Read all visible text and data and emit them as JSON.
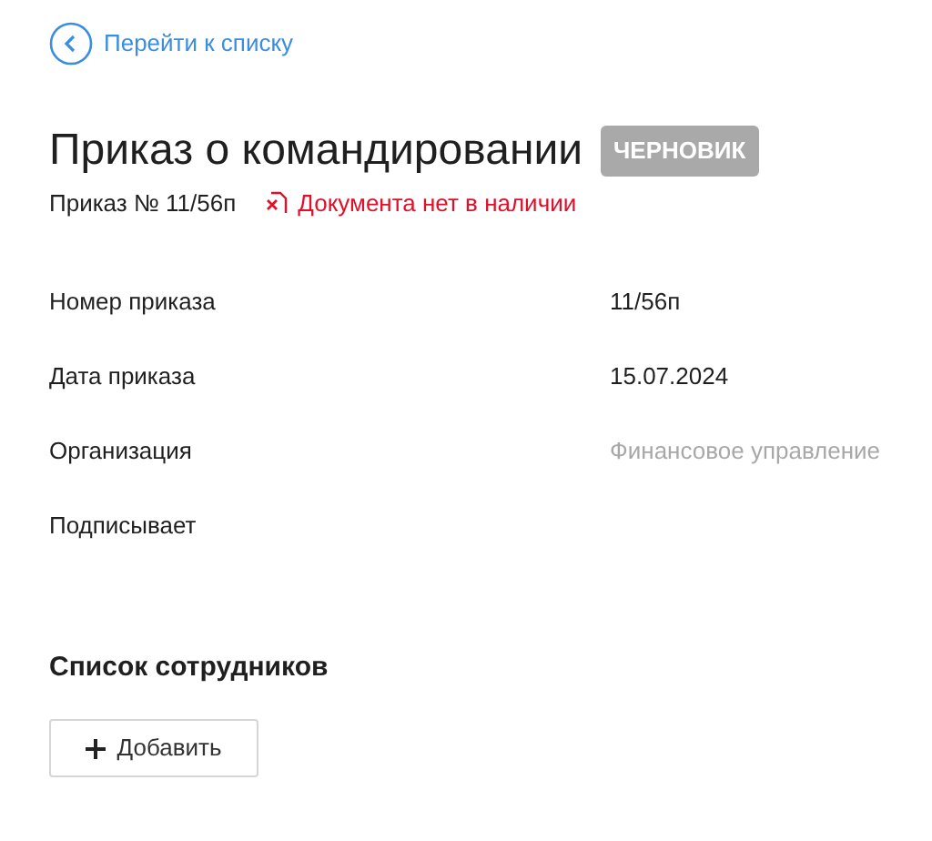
{
  "back_link": {
    "label": "Перейти к списку"
  },
  "header": {
    "title": "Приказ о командировании",
    "status_badge": "ЧЕРНОВИК",
    "subtitle": "Приказ № 11/56п",
    "warning": "Документа нет в наличии"
  },
  "fields": [
    {
      "label": "Номер приказа",
      "value": "11/56п",
      "disabled": false
    },
    {
      "label": "Дата приказа",
      "value": "15.07.2024",
      "disabled": false
    },
    {
      "label": "Организация",
      "value": "Финансовое управление",
      "disabled": true
    },
    {
      "label": "Подписывает"
    }
  ],
  "employees_section": {
    "title": "Список сотрудников",
    "add_button": "Добавить"
  }
}
